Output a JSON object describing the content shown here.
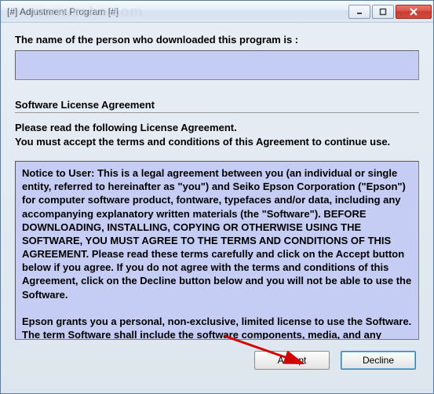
{
  "window": {
    "title": "[#] Adjustment Program  [#]"
  },
  "labels": {
    "name_prompt": "The name of the person who downloaded this program is :",
    "section_heading": "Software License Agreement",
    "instruction_line1": "Please read the following License Agreement.",
    "instruction_line2": "You must accept the terms and conditions of this Agreement to continue use."
  },
  "name_input": {
    "value": ""
  },
  "license_text": {
    "para1": "Notice to User: This is a legal agreement between you (an individual or single entity, referred to hereinafter as \"you\") and Seiko Epson Corporation (\"Epson\") for computer software product, fontware, typefaces and/or data, including any accompanying explanatory written materials (the \"Software\").  BEFORE DOWNLOADING, INSTALLING, COPYING OR OTHERWISE USING THE SOFTWARE, YOU MUST AGREE TO THE TERMS AND CONDITIONS OF THIS AGREEMENT.  Please read these terms carefully and click on the Accept button below if you agree.  If you do not agree with the terms and conditions of this Agreement, click on the Decline button below and you will not be able to use the Software.",
    "para2": "Epson grants you a personal, non-exclusive, limited license to use the Software.  The term Software shall include the software components, media, and any upgrades, modified versions, updates, additions of the Software licensed to you by Epson or its suppliers.  Epson and its suppliers"
  },
  "buttons": {
    "accept": "Accept",
    "decline": "Decline"
  },
  "watermark": "www.xsha.com",
  "colors": {
    "panel_bg": "#c5cdf5",
    "close_btn": "#c93c31"
  }
}
